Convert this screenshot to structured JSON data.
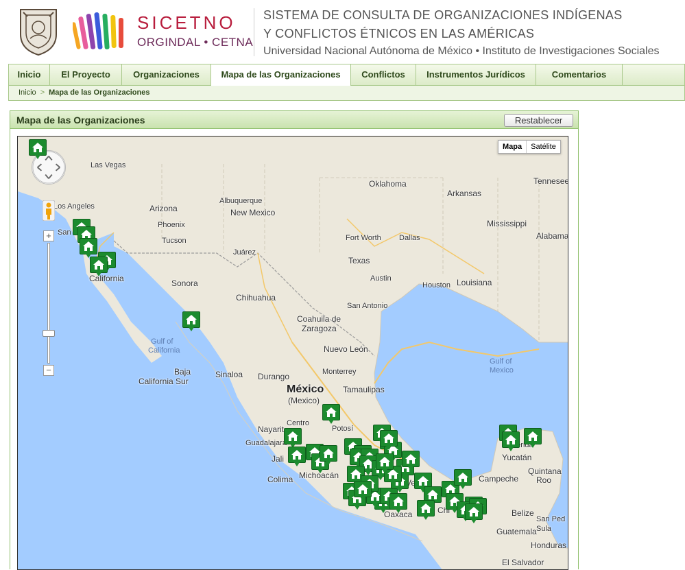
{
  "brand": {
    "name": "SICETNO",
    "sub": "ORGINDAL • CETNA",
    "title_line1": "SISTEMA DE CONSULTA DE ORGANIZACIONES INDÍGENAS",
    "title_line2": "Y CONFLICTOS ÉTNICOS EN LAS AMÉRICAS",
    "title_line3": "Universidad Nacional Autónoma de México • Instituto de Investigaciones Sociales"
  },
  "nav": {
    "items": [
      {
        "label": "Inicio"
      },
      {
        "label": "El Proyecto"
      },
      {
        "label": "Organizaciones"
      },
      {
        "label": "Mapa de las Organizaciones"
      },
      {
        "label": "Conflictos"
      },
      {
        "label": "Instrumentos Jurídicos"
      },
      {
        "label": "Comentarios"
      }
    ],
    "active_index": 3
  },
  "breadcrumb": {
    "home": "Inicio",
    "separator": ">",
    "current": "Mapa de las Organizaciones"
  },
  "panel": {
    "title": "Mapa de las Organizaciones",
    "reset_label": "Restablecer"
  },
  "map": {
    "type_map": "Mapa",
    "type_satellite": "Satélite",
    "zoom_in": "+",
    "zoom_out": "−",
    "labels": {
      "las_vegas": "Las Vegas",
      "los_angeles": "Los Angeles",
      "arizona": "Arizona",
      "phoenix": "Phoenix",
      "tucson": "Tucson",
      "albuquerque": "Albuquerque",
      "new_mexico": "New Mexico",
      "oklahoma": "Oklahoma",
      "arkansas": "Arkansas",
      "tennessee": "Tennesee",
      "mississippi": "Mississippi",
      "alabama": "Alabama",
      "fort_worth": "Fort Worth",
      "dallas": "Dallas",
      "texas": "Texas",
      "juarez": "Juárez",
      "austin": "Austin",
      "houston": "Houston",
      "louisiana": "Louisiana",
      "san_antonio": "San Antonio",
      "california": "California",
      "sonora": "Sonora",
      "chihuahua": "Chihuahua",
      "coahuila": "Coahuila de\nZaragoza",
      "coahuila_1": "Coahuila de",
      "coahuila_2": "Zaragoza",
      "nuevo_leon": "Nuevo León",
      "monterrey": "Monterrey",
      "gulf_ca_1": "Gulf of",
      "gulf_ca_2": "California",
      "baja_1": "Baja",
      "baja_2": "California Sur",
      "sinaloa": "Sinaloa",
      "durango": "Durango",
      "mexico": "México",
      "mexico_paren": "(Mexico)",
      "tamaulipas": "Tamaulipas",
      "gulf_mx_1": "Gulf of",
      "gulf_mx_2": "Mexico",
      "nayarit": "Nayarit",
      "centro": "Centro",
      "potosi": "Potosí",
      "guadalajara": "Guadalajara",
      "jalisco": "Jali",
      "michoacan": "Michoacán",
      "colima": "Colima",
      "oaxaca": "Oaxaca",
      "veracruz": "Verac",
      "chiapas": "Chi",
      "campeche": "Campeche",
      "yucatan": "Yucatán",
      "merida": "Mérida",
      "quintana_1": "Quintana",
      "quintana_2": "Roo",
      "belize": "Belize",
      "guatemala": "Guatemala",
      "san_pedro_1": "San Ped",
      "san_pedro_2": "Sula",
      "honduras": "Honduras",
      "el_salvador": "El Salvador",
      "san_short": "San"
    },
    "marker_icon": "house-icon",
    "marker_color": "#1c8b2e"
  }
}
